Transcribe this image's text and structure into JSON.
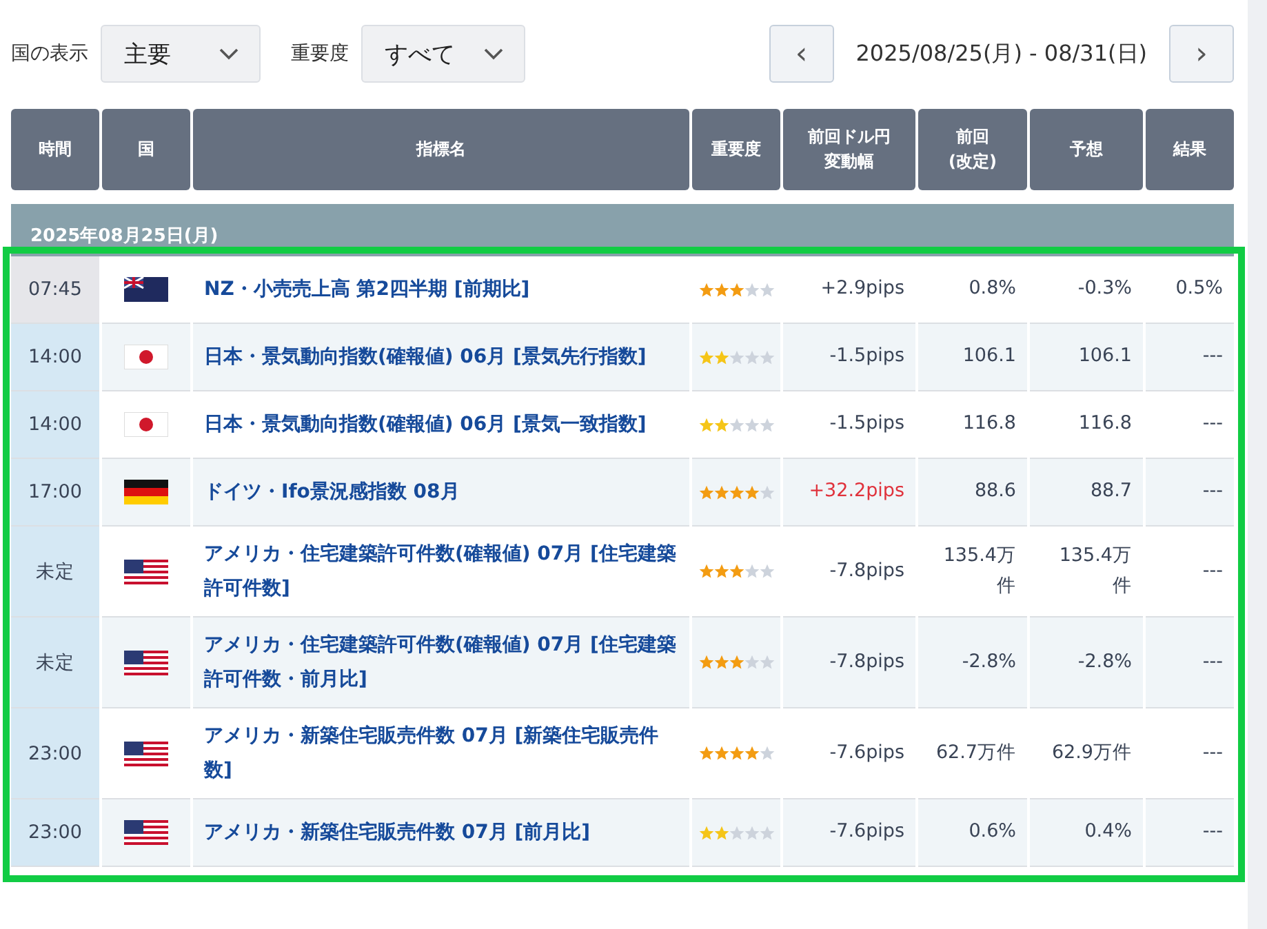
{
  "filters": [
    {
      "label": "国の表示",
      "value": "主要"
    },
    {
      "label": "重要度",
      "value": "すべて"
    }
  ],
  "week": {
    "prev": "‹",
    "range": "2025/08/25(月) - 08/31(日)",
    "next": "›"
  },
  "table": {
    "columns": [
      "時間",
      "国",
      "指標名",
      "重要度",
      "前回ドル円変動幅",
      "前回(改定)",
      "予想",
      "結果"
    ],
    "days": [
      {
        "date": "2025年08月25日(月)",
        "highlighted": true,
        "rows": [
          {
            "time": "07:45",
            "past": true,
            "kind": "nz",
            "name": "NZ・小売売上高 第2四半期 [前期比]",
            "stars": 3,
            "change": "+2.9pips",
            "change_hot": false,
            "previous": "0.8%",
            "forecast": "-0.3%",
            "result": "0.5%"
          },
          {
            "time": "14:00",
            "past": false,
            "kind": "jp",
            "name": "日本・景気動向指数(確報値) 06月 [景気先行指数]",
            "stars": 2,
            "change": "-1.5pips",
            "change_hot": false,
            "previous": "106.1",
            "forecast": "106.1",
            "result": "---"
          },
          {
            "time": "14:00",
            "past": false,
            "kind": "jp",
            "name": "日本・景気動向指数(確報値) 06月 [景気一致指数]",
            "stars": 2,
            "change": "-1.5pips",
            "change_hot": false,
            "previous": "116.8",
            "forecast": "116.8",
            "result": "---"
          },
          {
            "time": "17:00",
            "past": false,
            "kind": "de",
            "name": "ドイツ・Ifo景況感指数 08月",
            "stars": 4,
            "change": "+32.2pips",
            "change_hot": true,
            "previous": "88.6",
            "forecast": "88.7",
            "result": "---"
          },
          {
            "time": "未定",
            "past": false,
            "kind": "us",
            "name": "アメリカ・住宅建築許可件数(確報値) 07月 [住宅建築許可件数]",
            "stars": 3,
            "change": "-7.8pips",
            "change_hot": false,
            "previous": "135.4万件",
            "forecast": "135.4万件",
            "result": "---"
          },
          {
            "time": "未定",
            "past": false,
            "kind": "us",
            "name": "アメリカ・住宅建築許可件数(確報値) 07月 [住宅建築許可件数・前月比]",
            "stars": 3,
            "change": "-7.8pips",
            "change_hot": false,
            "previous": "-2.8%",
            "forecast": "-2.8%",
            "result": "---"
          },
          {
            "time": "23:00",
            "past": false,
            "kind": "us",
            "name": "アメリカ・新築住宅販売件数 07月 [新築住宅販売件数]",
            "stars": 4,
            "change": "-7.6pips",
            "change_hot": false,
            "previous": "62.7万件",
            "forecast": "62.9万件",
            "result": "---"
          },
          {
            "time": "23:00",
            "past": false,
            "kind": "us",
            "name": "アメリカ・新築住宅販売件数 07月 [前月比]",
            "stars": 2,
            "change": "-7.6pips",
            "change_hot": false,
            "previous": "0.6%",
            "forecast": "0.4%",
            "result": "---"
          }
        ]
      }
    ]
  }
}
